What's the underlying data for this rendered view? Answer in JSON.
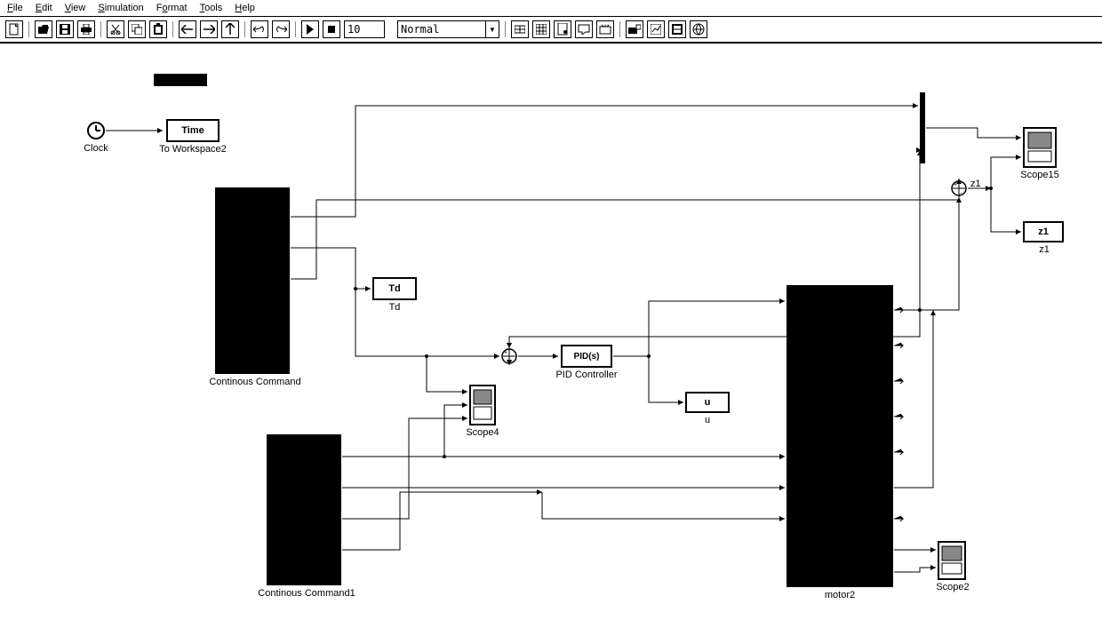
{
  "menu": {
    "file": "File",
    "edit": "Edit",
    "view": "View",
    "simulation": "Simulation",
    "format": "Format",
    "tools": "Tools",
    "help": "Help"
  },
  "toolbar": {
    "sim_time": "10",
    "mode": "Normal"
  },
  "blocks": {
    "clock_label": "Clock",
    "time": "Time",
    "to_workspace2": "To Workspace2",
    "continous_command": "Continous Command",
    "continous_command1": "Continous Command1",
    "td": "Td",
    "td_label": "Td",
    "pid": "PID(s)",
    "pid_label": "PID Controller",
    "u": "u",
    "u_label": "u",
    "scope4": "Scope4",
    "motor2": "motor2",
    "scope15": "Scope15",
    "scope2": "Scope2",
    "z1": "z1",
    "z1_label": "z1",
    "z1_signal": "z1"
  }
}
